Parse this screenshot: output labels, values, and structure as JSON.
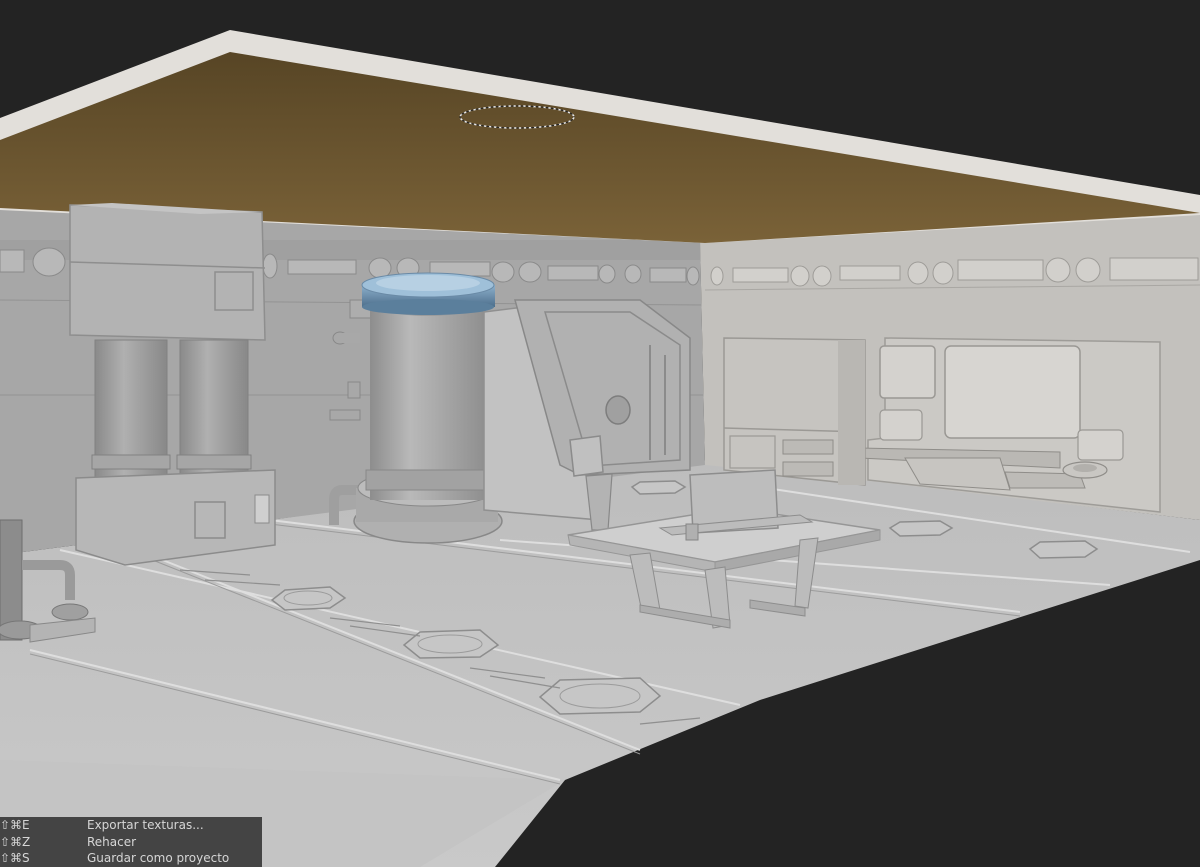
{
  "scene": {
    "description_colors": {
      "background": "#232323",
      "ceiling_underside": "#6a5632",
      "ceiling_edge": "#e4e1dc",
      "model_gray": "#a9a9a9",
      "capsule_top": "#6b90ad"
    }
  },
  "context_menu": {
    "items": [
      {
        "shortcut": "⇧⌘E",
        "label": "Exportar texturas..."
      },
      {
        "shortcut": "⇧⌘Z",
        "label": "Rehacer"
      },
      {
        "shortcut": "⇧⌘S",
        "label": "Guardar como proyecto"
      }
    ]
  }
}
